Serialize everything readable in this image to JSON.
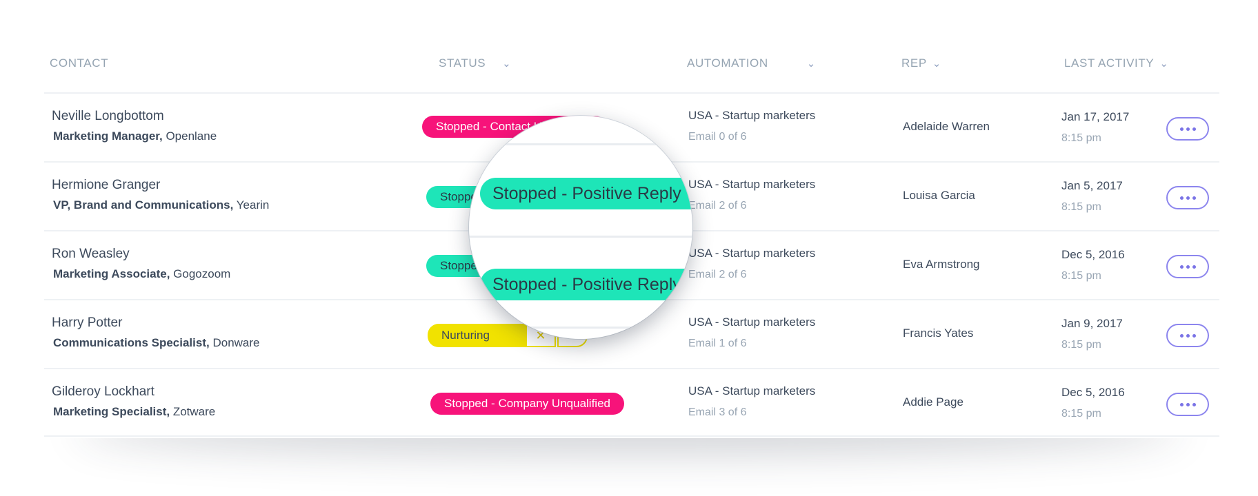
{
  "columns": {
    "contact": "CONTACT",
    "status": "STATUS",
    "automation": "AUTOMATION",
    "rep": "REP",
    "last_activity": "LAST ACTIVITY"
  },
  "rows": [
    {
      "name": "Neville Longbottom",
      "role": "Marketing Manager,",
      "company": " Openlane",
      "status": "Stopped - Contact Unqualified",
      "status_color": "#f7137a",
      "automation": "USA - Startup marketers",
      "step": "Email 0 of 6",
      "rep": "Adelaide Warren",
      "date": "Jan 17, 2017",
      "time": "8:15 pm"
    },
    {
      "name": "Hermione Granger",
      "role": "VP, Brand and Communications,",
      "company": " Yearin",
      "status": "Stopped - Positive Reply",
      "status_color": "#1ee5b8",
      "automation": "USA - Startup marketers",
      "step": "Email 2 of 6",
      "rep": "Louisa Garcia",
      "date": "Jan 5, 2017",
      "time": "8:15 pm"
    },
    {
      "name": "Ron Weasley",
      "role": "Marketing Associate,",
      "company": " Gogozoom",
      "status": "Stopped - Positive Reply",
      "status_color": "#1ee5b8",
      "automation": "USA - Startup marketers",
      "step": "Email 2 of 6",
      "rep": "Eva Armstrong",
      "date": "Dec 5, 2016",
      "time": "8:15 pm"
    },
    {
      "name": "Harry Potter",
      "role": "Communications Specialist,",
      "company": " Donware",
      "status": "Nurturing",
      "status_color": "#f1e200",
      "automation": "USA - Startup marketers",
      "step": "Email 1 of 6",
      "rep": "Francis Yates",
      "date": "Jan 9, 2017",
      "time": "8:15 pm"
    },
    {
      "name": "Gilderoy Lockhart",
      "role": "Marketing Specialist,",
      "company": " Zotware",
      "status": "Stopped - Company Unqualified",
      "status_color": "#f7137a",
      "automation": "USA - Startup marketers",
      "step": "Email 3 of 6",
      "rep": "Addie Page",
      "date": "Dec 5, 2016",
      "time": "8:15 pm"
    }
  ],
  "magnifier": {
    "badge_top": "Stopped - Positive Reply",
    "badge_bottom": "Stopped - Positive Reply"
  },
  "icons": {
    "column_sort": "chevron-down-icon",
    "row_menu": "more-horizontal-icon",
    "nurturing_action": "close-icon"
  }
}
